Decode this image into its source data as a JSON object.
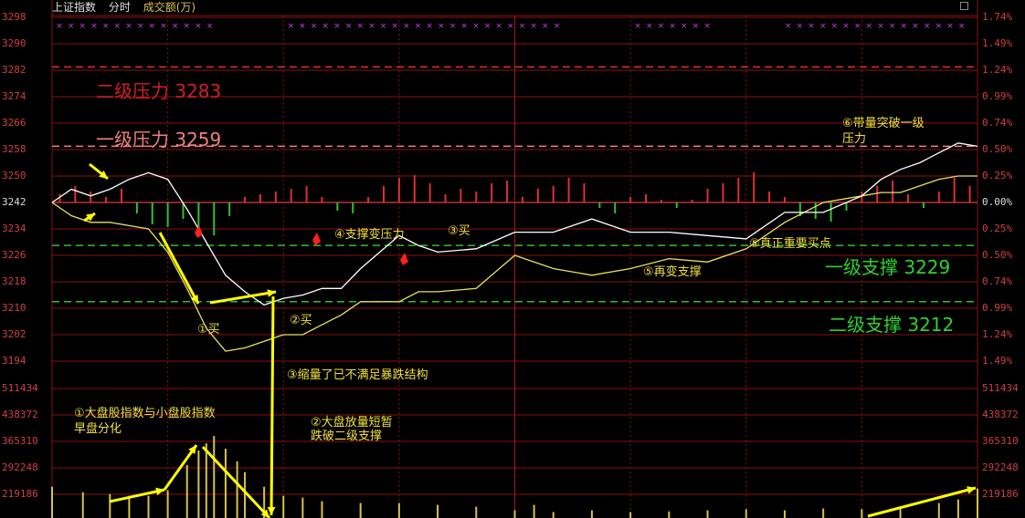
{
  "header": {
    "index_name": "上证指数",
    "mode": "分时",
    "volume_label": "成交额(万)"
  },
  "colors": {
    "grid": "#8a1010",
    "price_line": "#ffffff",
    "avg_line": "#e8e060",
    "up_bar": "#e03030",
    "down_bar": "#30c030",
    "volume_bar": "#d8c24a",
    "pressure": "#e03030",
    "pressure_light": "#f08080",
    "support": "#30c030",
    "annotation": "#f0e040",
    "arrow": "#ffff00",
    "marker": "#ff2020"
  },
  "price_axis": {
    "left_ticks": [
      "3298",
      "3290",
      "3282",
      "3274",
      "3266",
      "3258",
      "3250",
      "3242",
      "3234",
      "3226",
      "3218",
      "3210",
      "3202",
      "3194"
    ],
    "right_ticks": [
      "1.74%",
      "1.49%",
      "1.24%",
      "0.99%",
      "0.74%",
      "0.50%",
      "0.25%",
      "0.00%",
      "0.25%",
      "0.50%",
      "0.74%",
      "0.99%",
      "1.24%",
      "1.49%"
    ]
  },
  "volume_axis": {
    "ticks": [
      "511434",
      "438372",
      "365310",
      "292248",
      "219186"
    ],
    "partial_bottom": "146124"
  },
  "annotations": {
    "pressure2": "二级压力 3283",
    "pressure1": "一级压力 3259",
    "support1": "一级支撑 3229",
    "support2": "二级支撑 3212",
    "buy1": "①买",
    "buy2": "②买",
    "buy3": "③买",
    "note_shrink": "③缩量了已不满足暴跌结构",
    "note_support_to_pressure": "④支撑变压力",
    "note_resupport": "⑤再变支撑",
    "note_real_buy": "⑤真正重要买点",
    "note_breakout_l1": "⑥带量突破一级",
    "note_breakout_l2": "压力",
    "note_divergence_l1": "①大盘股指数与小盘股指数",
    "note_divergence_l2": "早盘分化",
    "note_breakdown_l1": "②大盘放量短暂",
    "note_breakdown_l2": "跌破二级支撑"
  },
  "chart_data": {
    "type": "line",
    "title": "上证指数 分时",
    "x_unit": "minutes from open (0-240)",
    "y_range": [
      3190,
      3300
    ],
    "baseline": 3242,
    "levels": {
      "pressure2": 3283,
      "pressure1": 3259,
      "support1": 3229,
      "support2": 3212
    },
    "series": [
      {
        "name": "price",
        "x": [
          0,
          5,
          10,
          15,
          20,
          25,
          30,
          35,
          40,
          45,
          50,
          55,
          60,
          65,
          70,
          75,
          80,
          85,
          90,
          95,
          100,
          110,
          120,
          130,
          140,
          150,
          160,
          170,
          180,
          190,
          200,
          210,
          215,
          220,
          225,
          230,
          235,
          240
        ],
        "values": [
          3242,
          3246,
          3244,
          3246,
          3249,
          3251,
          3249,
          3240,
          3230,
          3220,
          3215,
          3211,
          3213,
          3214,
          3216,
          3216,
          3222,
          3227,
          3232,
          3229,
          3227,
          3228,
          3233,
          3233,
          3237,
          3233,
          3233,
          3232,
          3231,
          3239,
          3239,
          3244,
          3249,
          3252,
          3254,
          3257,
          3260,
          3259
        ]
      },
      {
        "name": "avg",
        "x": [
          0,
          5,
          10,
          15,
          20,
          25,
          30,
          35,
          40,
          45,
          50,
          55,
          60,
          65,
          70,
          75,
          80,
          85,
          90,
          95,
          100,
          110,
          120,
          130,
          140,
          150,
          160,
          170,
          180,
          190,
          200,
          210,
          215,
          220,
          225,
          230,
          235,
          240
        ],
        "values": [
          3242,
          3238,
          3236,
          3236,
          3235,
          3234,
          3227,
          3216,
          3204,
          3197,
          3198,
          3200,
          3202,
          3202,
          3205,
          3208,
          3212,
          3212,
          3212,
          3215,
          3215,
          3216,
          3226,
          3222,
          3220,
          3222,
          3225,
          3224,
          3228,
          3236,
          3242,
          3244,
          3245,
          3245,
          3247,
          3249,
          3250,
          3250
        ]
      }
    ],
    "volume": {
      "ylim": [
        146124,
        511434
      ],
      "x": [
        0,
        8,
        15,
        20,
        25,
        30,
        35,
        38,
        40,
        42,
        45,
        48,
        50,
        55,
        60,
        65,
        70,
        80,
        90,
        100,
        110,
        120,
        125,
        130,
        140,
        150,
        160,
        170,
        180,
        190,
        200,
        210,
        220,
        230,
        235,
        240
      ],
      "values": [
        240000,
        225000,
        220000,
        215000,
        215000,
        230000,
        300000,
        340000,
        360000,
        380000,
        345000,
        310000,
        280000,
        240000,
        215000,
        210000,
        200000,
        195000,
        195000,
        190000,
        185000,
        175000,
        190000,
        170000,
        175000,
        170000,
        172000,
        175000,
        178000,
        175000,
        180000,
        178000,
        185000,
        195000,
        205000,
        235000
      ]
    },
    "secondary_bars": {
      "name": "momentum",
      "x": [
        2,
        6,
        10,
        14,
        18,
        22,
        26,
        30,
        34,
        38,
        42,
        46,
        50,
        54,
        58,
        62,
        66,
        70,
        74,
        78,
        82,
        86,
        90,
        94,
        98,
        102,
        106,
        110,
        114,
        118,
        122,
        126,
        130,
        134,
        138,
        142,
        146,
        150,
        154,
        158,
        162,
        166,
        170,
        174,
        178,
        182,
        186,
        190,
        194,
        198,
        202,
        206,
        210,
        214,
        218,
        222,
        226,
        230,
        234,
        238
      ],
      "values": [
        3,
        6,
        4,
        2,
        5,
        -4,
        -8,
        -9,
        -6,
        -10,
        -12,
        -5,
        2,
        3,
        4,
        5,
        6,
        2,
        -3,
        -4,
        2,
        6,
        9,
        10,
        7,
        3,
        5,
        4,
        7,
        8,
        2,
        5,
        6,
        9,
        7,
        -2,
        -4,
        2,
        3,
        1,
        -2,
        1,
        5,
        7,
        9,
        11,
        4,
        2,
        -5,
        -6,
        -7,
        -3,
        4,
        6,
        8,
        3,
        -2,
        4,
        9,
        6
      ]
    }
  }
}
